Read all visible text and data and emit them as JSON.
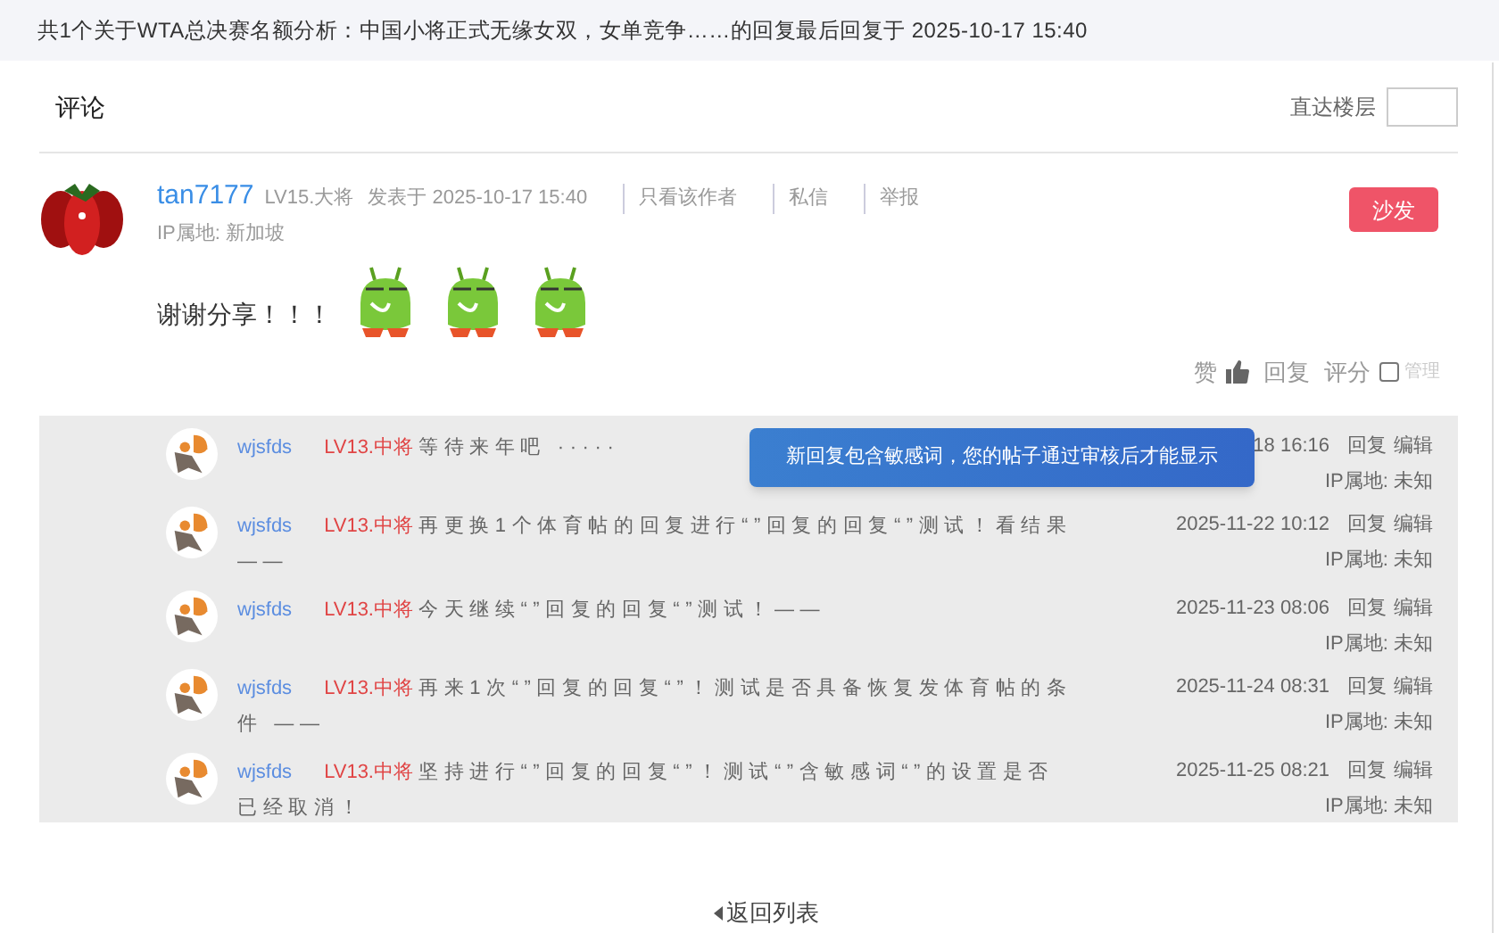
{
  "header": {
    "title": "共1个关于WTA总决赛名额分析：中国小将正式无缘女双，女单竞争……的回复最后回复于 2025-10-17 15:40"
  },
  "comments": {
    "title": "评论",
    "jump_label": "直达楼层"
  },
  "post": {
    "username": "tan7177",
    "level": "LV15.大将",
    "posted": "发表于 2025-10-17 15:40",
    "links": [
      "只看该作者",
      "私信",
      "举报"
    ],
    "ip": "IP属地: 新加坡",
    "floor_button": "沙发",
    "body": "谢谢分享！！！",
    "stickers": [
      {
        "kind": "monster"
      },
      {
        "kind": "monster"
      },
      {
        "kind": "monster"
      }
    ],
    "actions": {
      "like": "赞",
      "reply": "回复",
      "rate": "评分",
      "manage": "管理",
      "manage_checked": false
    }
  },
  "replies": [
    {
      "username": "wjsfds",
      "level": "LV13.中将",
      "text": "等待来年吧 ·····",
      "date": "18 16:16",
      "reply": "回复",
      "edit": "编辑",
      "ip": "IP属地: 未知"
    },
    {
      "username": "wjsfds",
      "level": "LV13.中将",
      "text": "再更换1个体育帖的回复进行“”回复的回复“”测试！看结果 ——",
      "date": "2025-11-22 10:12",
      "reply": "回复",
      "edit": "编辑",
      "ip": "IP属地: 未知"
    },
    {
      "username": "wjsfds",
      "level": "LV13.中将",
      "text": "今天继续“”回复的回复“”测试！——",
      "date": "2025-11-23 08:06",
      "reply": "回复",
      "edit": "编辑",
      "ip": "IP属地: 未知"
    },
    {
      "username": "wjsfds",
      "level": "LV13.中将",
      "text": "再来1次“”回复的回复“”！测试是否具备恢复发体育帖的条件 ——",
      "date": "2025-11-24 08:31",
      "reply": "回复",
      "edit": "编辑",
      "ip": "IP属地: 未知"
    },
    {
      "username": "wjsfds",
      "level": "LV13.中将",
      "text": "坚持进行“”回复的回复“”！测试“”含敏感词“”的设置是否已经取消！",
      "date": "2025-11-25 08:21",
      "reply": "回复",
      "edit": "编辑",
      "ip": "IP属地: 未知"
    }
  ],
  "toast": "新回复包含敏感词，您的帖子通过审核后才能显示",
  "back_link": "返回列表"
}
